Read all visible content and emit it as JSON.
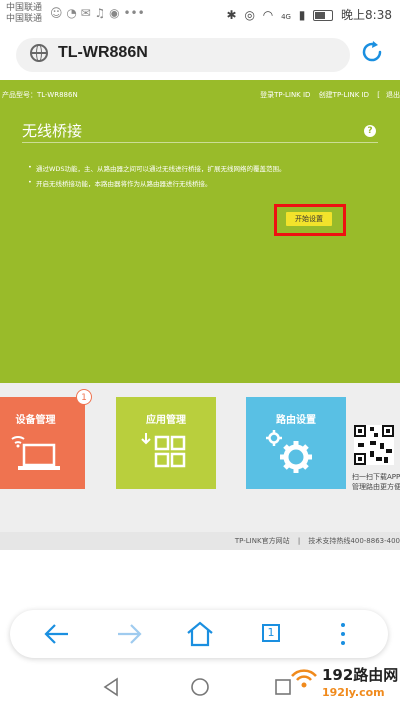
{
  "status_bar": {
    "carrier_1": "中国联通",
    "carrier_2": "中国联通",
    "network_label": "4G",
    "battery_percent": 60,
    "time": "晚上8:38"
  },
  "browser": {
    "url": "TL-WR886N",
    "tab_count": "1"
  },
  "router_page": {
    "model_label": "产品型号：TL-WR886N",
    "top_links": [
      "登录TP-LINK ID",
      "创建TP-LINK ID",
      "退出"
    ],
    "title": "无线桥接",
    "help_label": "?",
    "descriptions": [
      "通过WDS功能，主、从路由器之间可以通过无线进行桥接，扩展无线网络的覆盖范围。",
      "开启无线桥接功能，本路由器将作为从路由器进行无线桥接。"
    ],
    "start_button": "开始设置",
    "tiles": [
      {
        "label": "设备管理",
        "icon": "laptop-wifi-icon",
        "color": "#ef7350",
        "badge": "1"
      },
      {
        "label": "应用管理",
        "icon": "apps-grid-icon",
        "color": "#b9cf3d"
      },
      {
        "label": "路由设置",
        "icon": "gears-icon",
        "color": "#59c0e4"
      }
    ],
    "qr_caption_1": "扫一扫下载APP",
    "qr_caption_2": "管理路由更方便",
    "footer_link": "TP-LINK官方网站",
    "footer_divider": "|",
    "footer_hotline": "技术支持热线400-8863-400"
  },
  "watermark": {
    "brand": "192路由网",
    "domain": "192ly.com"
  },
  "accent": "#99bb2a",
  "highlight": "#e11111"
}
